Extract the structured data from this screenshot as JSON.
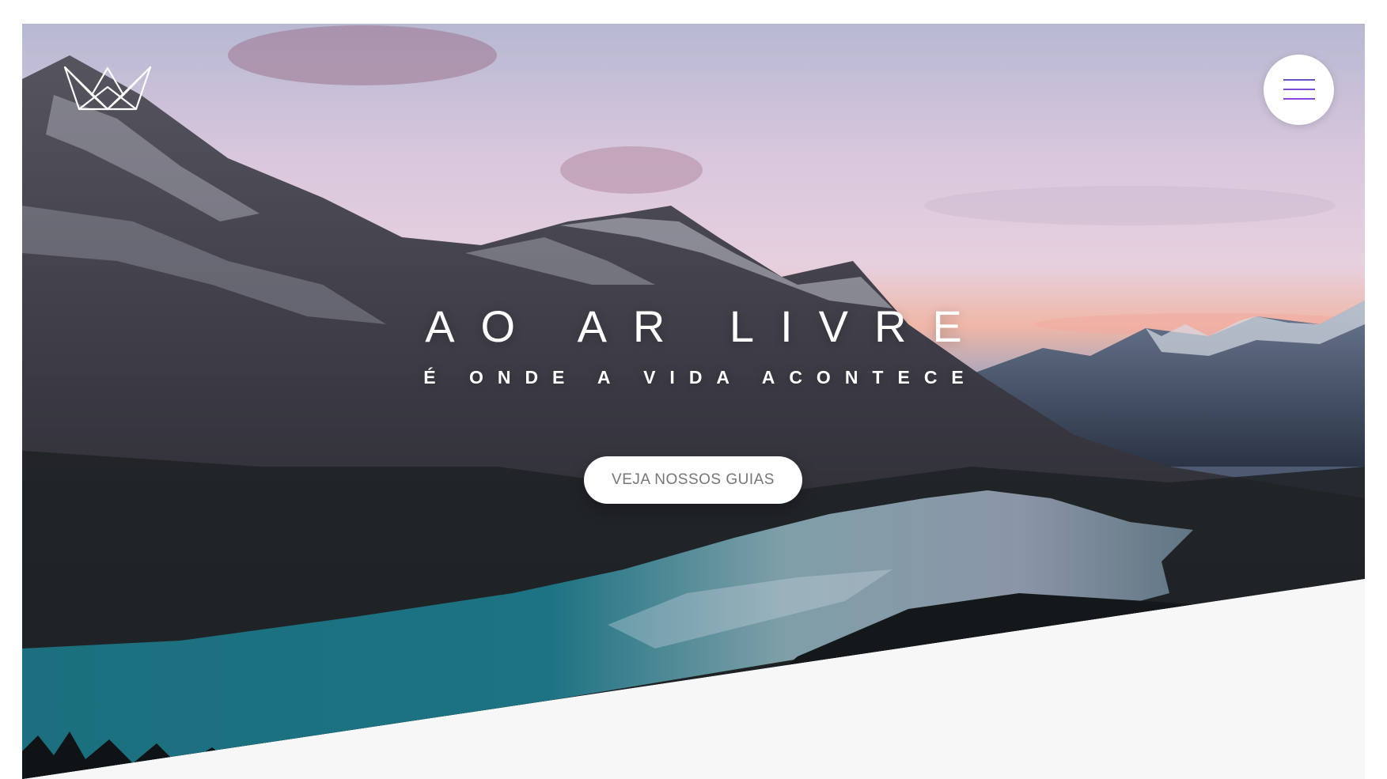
{
  "header": {
    "logo_icon": "crown-logo-icon",
    "menu_icon": "hamburger-menu-icon"
  },
  "hero": {
    "title": "AO AR LIVRE",
    "subtitle": "É ONDE A VIDA ACONTECE",
    "cta_label": "VEJA NOSSOS GUIAS",
    "background_image": "mountain-lake-landscape"
  },
  "colors": {
    "menu_accent": "#7a4fd6",
    "cta_text": "#777777",
    "section_bg": "#f7f7f7"
  }
}
